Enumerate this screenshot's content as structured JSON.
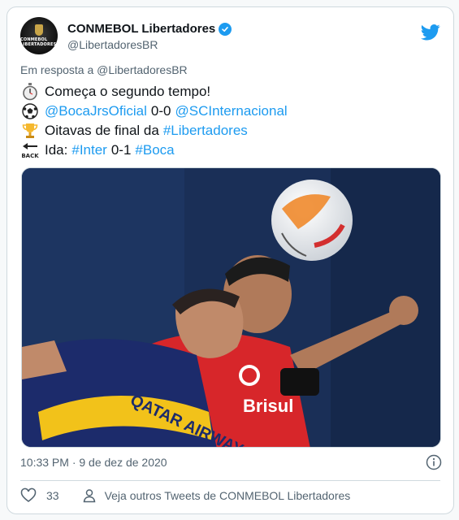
{
  "account": {
    "display_name": "CONMEBOL Libertadores",
    "handle": "@LibertadoresBR",
    "avatar_text": "CONMEBOL LIBERTADORES",
    "verified": true
  },
  "reply": {
    "prefix": "Em resposta a",
    "mention": "@LibertadoresBR"
  },
  "tweet": {
    "line1": {
      "icon": "stopwatch-icon",
      "text": "Começa o segundo tempo!"
    },
    "line2": {
      "icon": "soccer-ball-icon",
      "team_a": "@BocaJrsOficial",
      "score": "0-0",
      "team_b": "@SCInternacional"
    },
    "line3": {
      "icon": "trophy-icon",
      "text": "Oitavas de final da",
      "hashtag": "#Libertadores"
    },
    "line4": {
      "icon": "back-arrow-icon",
      "icon_text": "BACK",
      "prefix": "Ida:",
      "team_a": "#Inter",
      "score": "0-1",
      "team_b": "#Boca"
    }
  },
  "media": {
    "jersey_text": "QATAR AIRWAYS",
    "jersey_text_2": "AIRWAYS",
    "red_jersey_text": "Brisul"
  },
  "meta": {
    "timestamp": "10:33 PM · 9 de dez de 2020"
  },
  "actions": {
    "likes": "33",
    "more_tweets": "Veja outros Tweets de CONMEBOL Libertadores"
  },
  "colors": {
    "link": "#1d9bf0",
    "muted": "#536471",
    "border": "#cfd9de"
  }
}
